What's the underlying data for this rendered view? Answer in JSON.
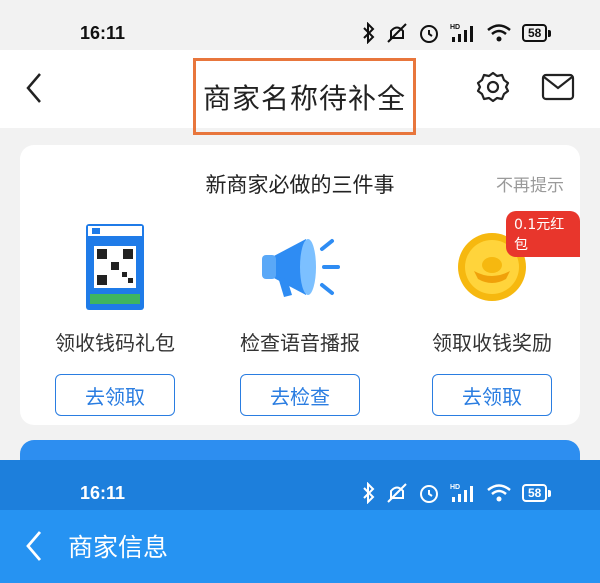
{
  "status_bar": {
    "time": "16:11",
    "battery": "58"
  },
  "top_header": {
    "title": "商家名称待补全"
  },
  "card": {
    "title": "新商家必做的三件事",
    "dismiss": "不再提示",
    "items": [
      {
        "label": "领收钱码礼包",
        "button": "去领取",
        "icon": "qr-code-card-icon"
      },
      {
        "label": "检查语音播报",
        "button": "去检查",
        "icon": "megaphone-icon"
      },
      {
        "label": "领取收钱奖励",
        "button": "去领取",
        "icon": "gold-coin-icon",
        "badge": "0.1元红包"
      }
    ]
  },
  "second_screen": {
    "title": "商家信息"
  },
  "colors": {
    "accent": "#2a7de1",
    "highlight_box": "#e8763c",
    "badge": "#e8362c"
  }
}
